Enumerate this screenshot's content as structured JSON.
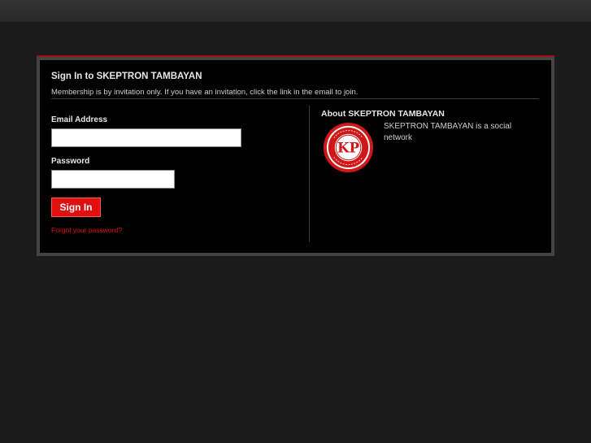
{
  "header": {
    "title": "Sign In to SKEPTRON TAMBAYAN",
    "subtitle": "Membership is by invitation only. If you have an invitation, click the link in the email to join."
  },
  "form": {
    "email_label": "Email Address",
    "email_value": "",
    "password_label": "Password",
    "password_value": "",
    "signin_label": "Sign In",
    "forgot_label": "Forgot your password?"
  },
  "about": {
    "title": "About SKEPTRON TAMBAYAN",
    "description": "SKEPTRON TAMBAYAN is a social network",
    "logo_text": "KAPPA KAPPA RHO · KKP"
  },
  "colors": {
    "accent": "#e01010",
    "background": "#1b1b1b",
    "panel": "#000000"
  }
}
